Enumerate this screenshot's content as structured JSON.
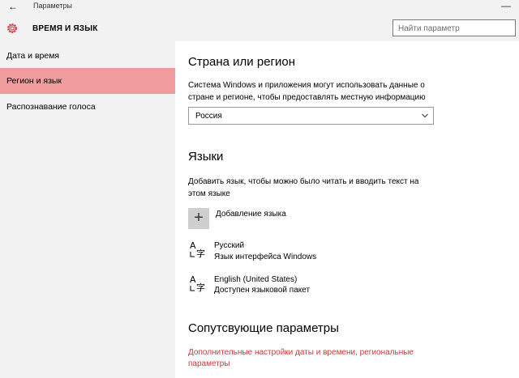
{
  "window": {
    "title": "Параметры"
  },
  "header": {
    "title": "ВРЕМЯ И ЯЗЫК",
    "search_placeholder": "Найти параметр"
  },
  "sidebar": {
    "items": [
      {
        "label": "Дата и время",
        "active": false
      },
      {
        "label": "Регион и язык",
        "active": true
      },
      {
        "label": "Распознавание голоса",
        "active": false
      }
    ]
  },
  "region": {
    "heading": "Страна или регион",
    "description": "Система Windows и приложения могут использовать данные о стране и регионе, чтобы предоставлять местную информацию",
    "selected": "Россия"
  },
  "languages": {
    "heading": "Языки",
    "description": "Добавить язык, чтобы можно было читать и вводить текст на этом языке",
    "add_label": "Добавление языка",
    "items": [
      {
        "name": "Русский",
        "status": "Язык интерфейса Windows",
        "icon": "language-icon"
      },
      {
        "name": "English (United States)",
        "status": "Доступен языковой пакет",
        "icon": "language-icon"
      }
    ]
  },
  "related": {
    "heading": "Сопутсвующие параметры",
    "link": "Дополнительные настройки даты и времени, региональные параметры"
  },
  "colors": {
    "accent": "#d13438",
    "active_nav": "#f09b9e",
    "chrome": "#f2f2f2"
  }
}
